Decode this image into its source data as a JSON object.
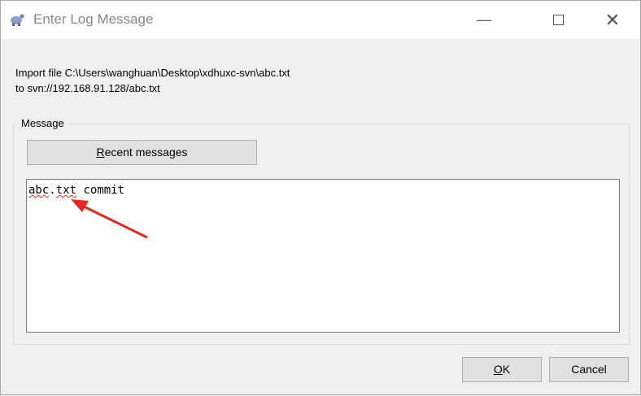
{
  "window": {
    "title": "Enter Log Message",
    "minimize_icon": "minimize-icon",
    "maximize_icon": "maximize-icon",
    "close_icon": "close-icon"
  },
  "info": {
    "line1": "Import file C:\\Users\\wanghuan\\Desktop\\xdhuxc-svn\\abc.txt",
    "line2": "to svn://192.168.91.128/abc.txt"
  },
  "message": {
    "group_label": "Message",
    "recent_prefix": "R",
    "recent_rest": "ecent messages",
    "text_part1": "abc",
    "text_part2": ".",
    "text_part3": "txt",
    "text_part4": " commit"
  },
  "buttons": {
    "ok_prefix": "O",
    "ok_rest": "K",
    "cancel": "Cancel"
  },
  "annotation": {
    "arrow_color": "#e8281e"
  }
}
